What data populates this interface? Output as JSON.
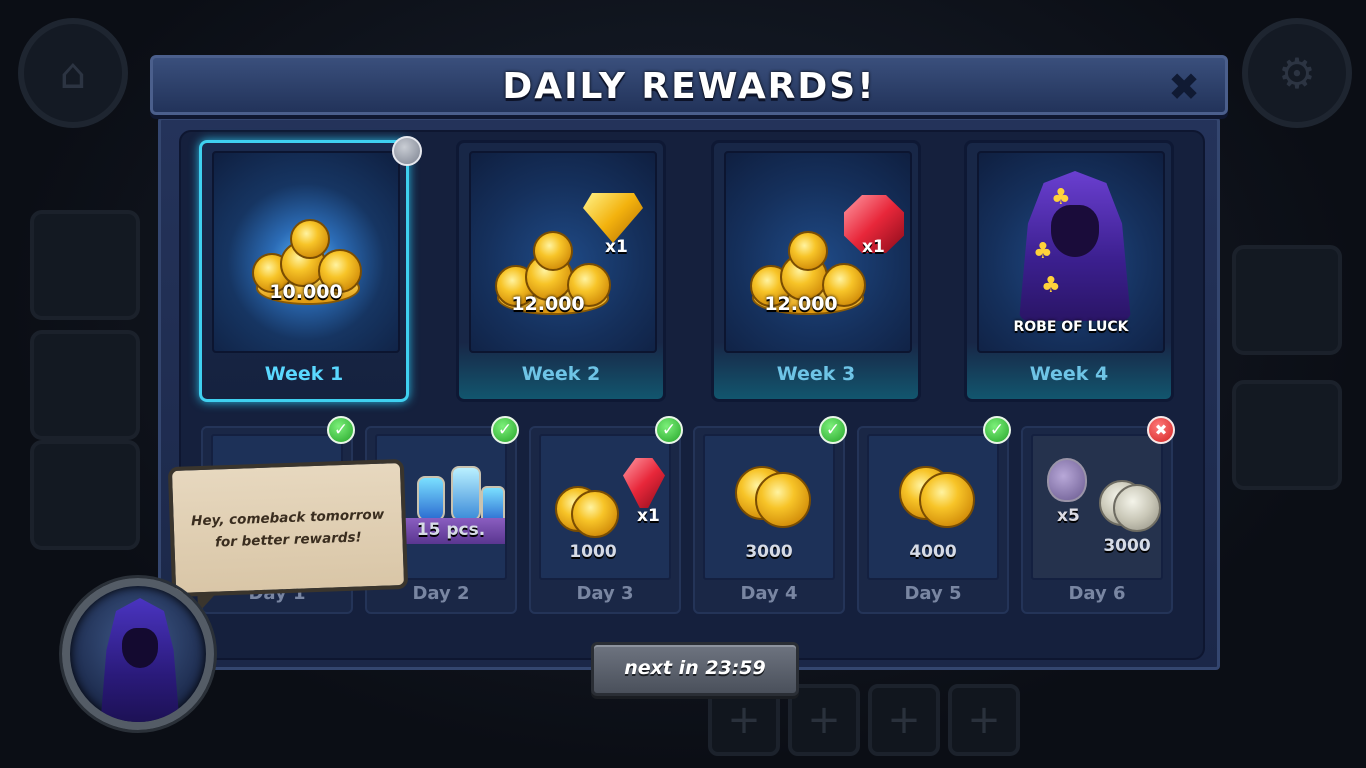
{
  "modal": {
    "title": "DAILY REWARDS!",
    "close_icon": "close-icon"
  },
  "weeks": [
    {
      "label": "Week 1",
      "reward": "10.000",
      "reward_type": "gold",
      "selected": true
    },
    {
      "label": "Week 2",
      "reward": "12.000",
      "reward_type": "gold",
      "bonus": "x1",
      "bonus_type": "yellow-gem"
    },
    {
      "label": "Week 3",
      "reward": "12.000",
      "reward_type": "gold",
      "bonus": "x1",
      "bonus_type": "red-gem"
    },
    {
      "label": "Week 4",
      "reward": "ROBE OF LUCK",
      "reward_type": "robe"
    }
  ],
  "days": [
    {
      "label": "Day 1",
      "status": "claimed"
    },
    {
      "label": "Day 2",
      "reward": "15 pcs.",
      "reward_type": "potions",
      "status": "claimed"
    },
    {
      "label": "Day 3",
      "reward": "1000",
      "bonus": "x1",
      "bonus_type": "red-gem",
      "status": "claimed"
    },
    {
      "label": "Day 4",
      "reward": "3000",
      "status": "claimed"
    },
    {
      "label": "Day 5",
      "reward": "4000",
      "status": "claimed"
    },
    {
      "label": "Day 6",
      "reward": "3000",
      "bonus": "x5",
      "bonus_type": "potion",
      "status": "missed"
    }
  ],
  "speech": {
    "text": "Hey, comeback tomorrow for better rewards!"
  },
  "next_button": {
    "label": "next in 23:59"
  },
  "colors": {
    "accent": "#3fd0f0",
    "claimed": "#26a52a",
    "missed": "#d42424",
    "panel": "#15203d"
  }
}
